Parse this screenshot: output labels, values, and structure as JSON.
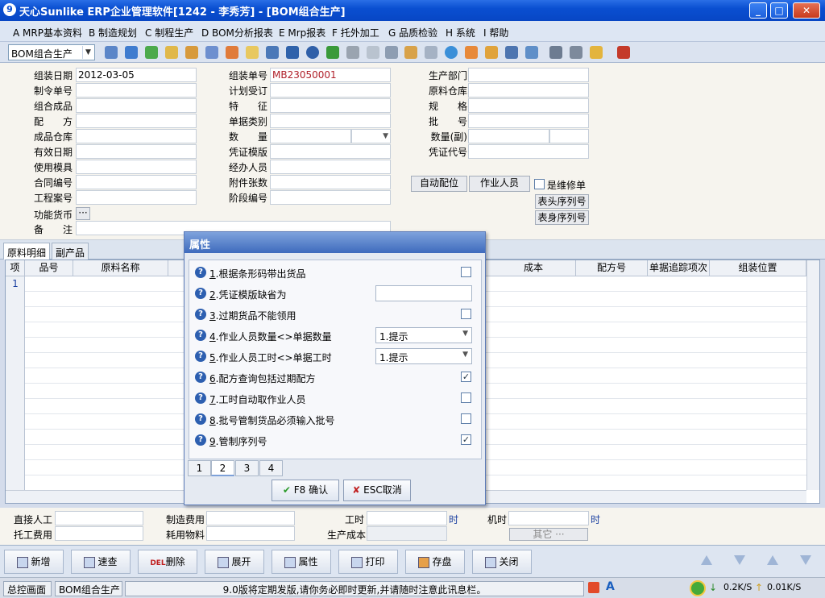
{
  "window": {
    "title": "天心Sunlike ERP企业管理软件[1242 - 李秀芳] - [BOM组合生产]",
    "icon": "app-logo-icon",
    "buttons": {
      "minimize": "_",
      "maximize": "□",
      "close": "✕"
    }
  },
  "menu": [
    {
      "label": "A MRP基本资料"
    },
    {
      "label": "B 制造规划"
    },
    {
      "label": "C 制程生产"
    },
    {
      "label": "D BOM分析报表"
    },
    {
      "label": "E Mrp报表"
    },
    {
      "label": "F 托外加工"
    },
    {
      "label": "G 品质检验"
    },
    {
      "label": "H 系统"
    },
    {
      "label": "I 帮助"
    }
  ],
  "toolbar": {
    "form_select": "BOM组合生产",
    "dropdown_arrow": "▼"
  },
  "header": {
    "col1": [
      {
        "label": "组装日期",
        "value": "2012-03-05"
      },
      {
        "label": "制令单号",
        "value": ""
      },
      {
        "label": "组合成品",
        "value": ""
      },
      {
        "label": "配　　方",
        "value": ""
      },
      {
        "label": "成品仓库",
        "value": ""
      },
      {
        "label": "有效日期",
        "value": ""
      },
      {
        "label": "使用模具",
        "value": ""
      },
      {
        "label": "合同编号",
        "value": ""
      },
      {
        "label": "工程案号",
        "value": ""
      }
    ],
    "col2": [
      {
        "label": "组装单号",
        "value": "MB23050001"
      },
      {
        "label": "计划受订",
        "value": ""
      },
      {
        "label": "特　　征",
        "value": ""
      },
      {
        "label": "单据类别",
        "value": ""
      },
      {
        "label": "数　　量",
        "value": ""
      },
      {
        "label": "凭证模版",
        "value": ""
      },
      {
        "label": "经办人员",
        "value": ""
      },
      {
        "label": "附件张数",
        "value": ""
      },
      {
        "label": "阶段编号",
        "value": ""
      }
    ],
    "col3": [
      {
        "label": "生产部门",
        "value": ""
      },
      {
        "label": "原料仓库",
        "value": ""
      },
      {
        "label": "规　　格",
        "value": ""
      },
      {
        "label": "批　　号",
        "value": ""
      },
      {
        "label": "数量(副)",
        "value": ""
      },
      {
        "label": "凭证代号",
        "value": ""
      }
    ],
    "currency_label": "功能货币",
    "remark_label": "备　　注",
    "ellipsis": "···",
    "auto_config": "自动配位",
    "worker_button": "作业人员",
    "repair_label": "是维修单",
    "head_serial": "表头序列号",
    "body_serial": "表身序列号"
  },
  "tabs": [
    {
      "label": "原料明细"
    },
    {
      "label": "副产品"
    }
  ],
  "grid": {
    "columns": [
      "项",
      "品号",
      "原料名称",
      "成本",
      "配方号",
      "单据追踪项次",
      "组装位置"
    ],
    "row1": "1"
  },
  "bottom": {
    "direct_labor": "直接人工",
    "outsource_fee": "托工费用",
    "mfg_fee": "制造费用",
    "consumables": "耗用物料",
    "labor_time": "工时",
    "unit_time": "时",
    "machine_time": "机时",
    "prod_cost": "生产成本",
    "other": "其它 ···"
  },
  "commands": [
    {
      "label": "新增"
    },
    {
      "label": "速查"
    },
    {
      "label": "删除",
      "prefix": "DEL"
    },
    {
      "label": "展开"
    },
    {
      "label": "属性"
    },
    {
      "label": "打印"
    },
    {
      "label": "存盘"
    },
    {
      "label": "关闭"
    }
  ],
  "status": {
    "home": "总控画面",
    "current": "BOM组合生产",
    "message": "9.0版将定期发版,请你务必即时更新,并请随时注意此讯息栏。",
    "down": "0.2K/S",
    "up": "0.01K/S"
  },
  "dialog": {
    "title": "属性",
    "props": [
      {
        "num": "1",
        "text": ".根据条形码带出货品",
        "type": "check",
        "checked": ""
      },
      {
        "num": "2",
        "text": ".凭证模版缺省为",
        "type": "text",
        "value": ""
      },
      {
        "num": "3",
        "text": ".过期货品不能领用",
        "type": "check",
        "checked": ""
      },
      {
        "num": "4",
        "text": ".作业人员数量<>单据数量",
        "type": "select",
        "value": "1.提示"
      },
      {
        "num": "5",
        "text": ".作业人员工时<>单据工时",
        "type": "select",
        "value": "1.提示"
      },
      {
        "num": "6",
        "text": ".配方查询包括过期配方",
        "type": "check",
        "checked": "✓"
      },
      {
        "num": "7",
        "text": ".工时自动取作业人员",
        "type": "check",
        "checked": ""
      },
      {
        "num": "8",
        "text": ".批号管制货品必须输入批号",
        "type": "check",
        "checked": ""
      },
      {
        "num": "9",
        "text": ".管制序列号",
        "type": "check",
        "checked": "✓"
      }
    ],
    "pages": [
      "1",
      "2",
      "3",
      "4"
    ],
    "ok": "F8 确认",
    "cancel": "ESC取消",
    "question": "?",
    "sel_arrow": "▼"
  }
}
